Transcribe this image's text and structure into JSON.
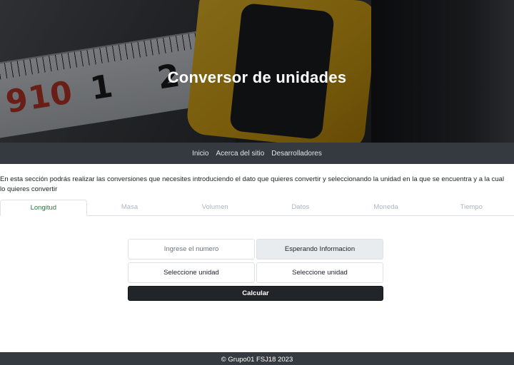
{
  "header": {
    "title": "Conversor de unidades"
  },
  "nav": {
    "items": [
      "Inicio",
      "Acerca del sitio",
      "Desarrolladores"
    ]
  },
  "intro": {
    "text": "En esta sección podrás realizar las conversiones que necesites introduciendo el dato que quieres convertir y seleccionando la unidad en la que se encuentra y a la cual lo quieres convertir"
  },
  "tabs": [
    "Longitud",
    "Masa",
    "Volumen",
    "Datos",
    "Moneda",
    "Tiempo"
  ],
  "active_tab": "Longitud",
  "form": {
    "input_placeholder": "Ingrese el numero",
    "result_text": "Esperando Informacion",
    "unit_from": "Seleccione unidad",
    "unit_to": "Seleccione unidad",
    "calculate_label": "Calcular"
  },
  "footer": {
    "text": "© Grupo01 FSJ18 2023"
  },
  "colors": {
    "nav_bg": "#353a40",
    "active_tab": "#1f7a3e",
    "button_bg": "#212529"
  }
}
